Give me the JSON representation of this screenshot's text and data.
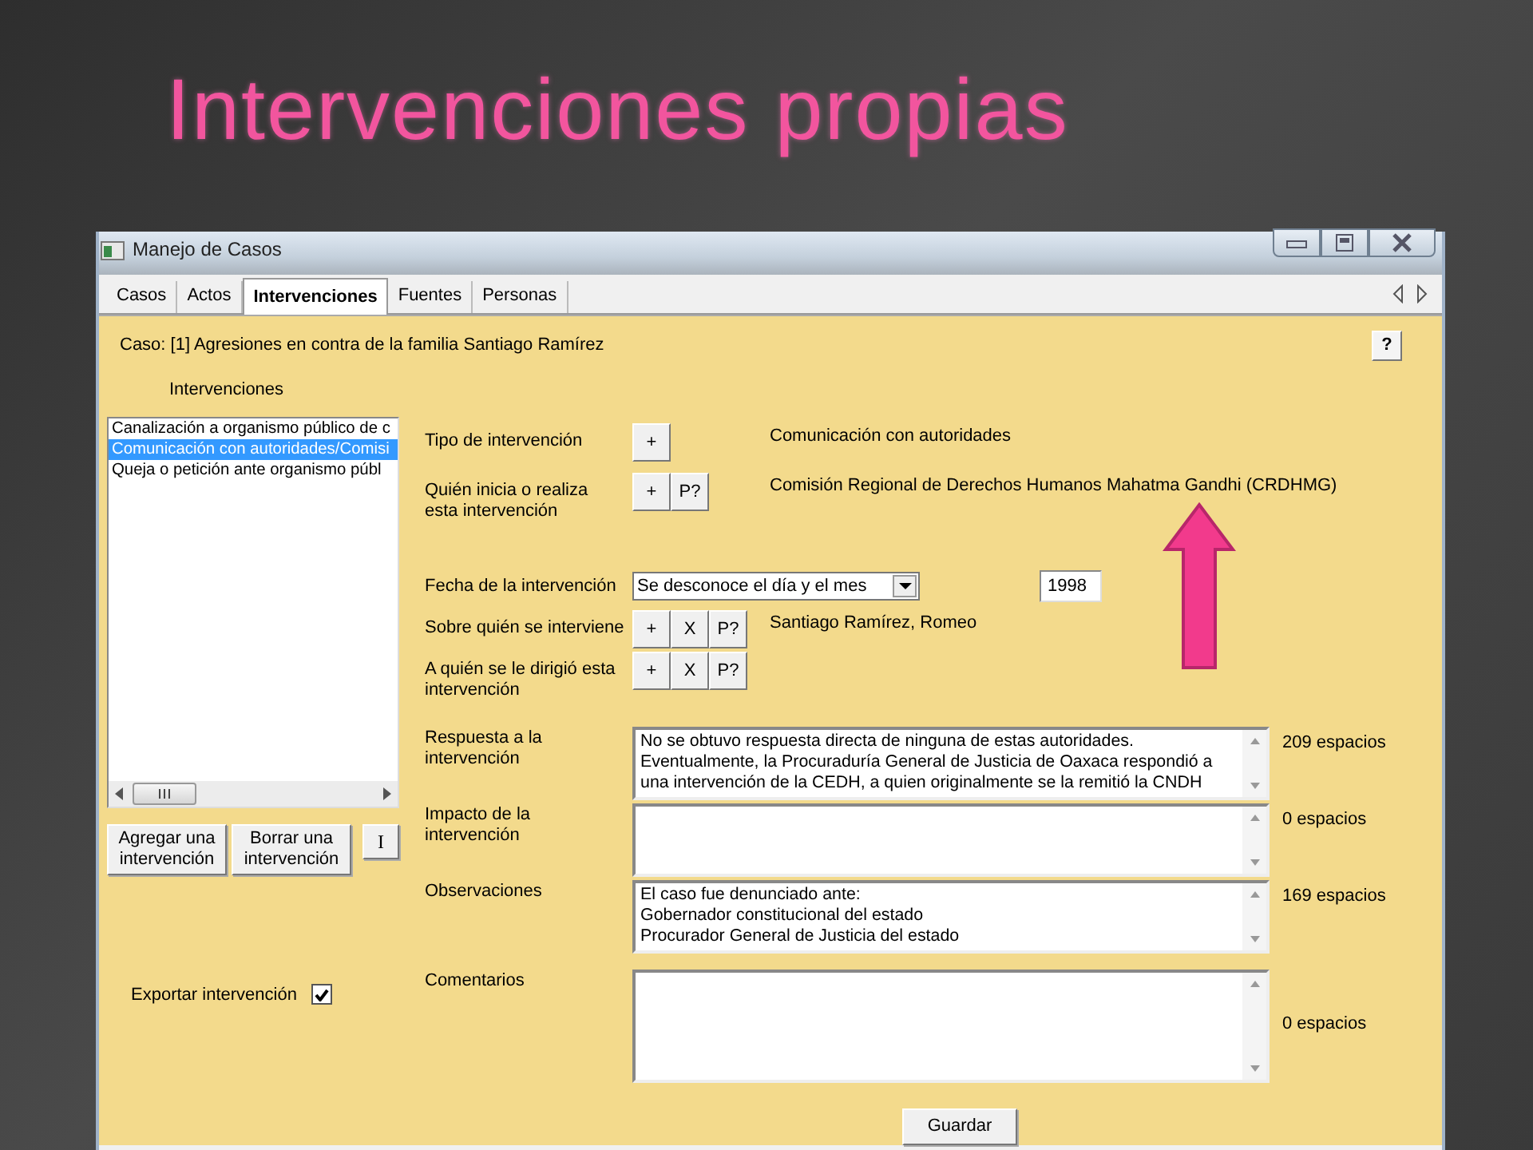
{
  "slide_title": "Intervenciones propias",
  "window": {
    "title": "Manejo de Casos"
  },
  "tabs": [
    {
      "label": "Casos",
      "selected": false
    },
    {
      "label": "Actos",
      "selected": false
    },
    {
      "label": "Intervenciones",
      "selected": true
    },
    {
      "label": "Fuentes",
      "selected": false
    },
    {
      "label": "Personas",
      "selected": false
    }
  ],
  "case_label": "Caso: [1] Agresiones en contra de la familia Santiago Ramírez",
  "help_button": "?",
  "interventions": {
    "heading": "Intervenciones",
    "items": [
      {
        "text": "Canalización a organismo público de c",
        "selected": false
      },
      {
        "text": "Comunicación con autoridades/Comisi",
        "selected": true
      },
      {
        "text": "Queja o petición ante organismo públ",
        "selected": false
      }
    ],
    "buttons": [
      "Agregar una intervención",
      "Borrar una intervención",
      "I"
    ]
  },
  "export": {
    "label": "Exportar intervención",
    "checked": true
  },
  "fields": [
    {
      "kind": "buttons",
      "label": "Tipo de intervención",
      "buttons": [
        "+"
      ],
      "value": "Comunicación con autoridades"
    },
    {
      "kind": "buttons",
      "label": "Quién inicia o realiza\nesta intervención",
      "buttons": [
        "+",
        "P?"
      ],
      "value": "Comisión Regional de Derechos Humanos Mahatma Gandhi (CRDHMG)"
    },
    {
      "kind": "date",
      "label": "Fecha de la intervención",
      "select": "Se desconoce el día y el mes",
      "year": "1998"
    },
    {
      "kind": "buttons",
      "label": "Sobre quién se interviene",
      "buttons": [
        "+",
        "X",
        "P?"
      ],
      "value": "Santiago Ramírez, Romeo"
    },
    {
      "kind": "buttons",
      "label": "A quién se le dirigió esta\nintervención",
      "buttons": [
        "+",
        "X",
        "P?"
      ]
    },
    {
      "kind": "textarea",
      "label": "Respuesta a la\nintervención",
      "text": "No se obtuvo respuesta directa de ninguna de estas autoridades.\nEventualmente, la Procuraduría General de Justicia de Oaxaca respondió a\nuna intervención de la CEDH, a quien originalmente se la remitió la CNDH",
      "count": "209 espacios"
    },
    {
      "kind": "textarea",
      "label": "Impacto de la\nintervención",
      "count": "0 espacios"
    },
    {
      "kind": "textarea",
      "label": "Observaciones",
      "text": "El caso fue denunciado ante:\nGobernador constitucional del estado\nProcurador General de Justicia del estado",
      "count": "169 espacios"
    },
    {
      "kind": "bigtextarea",
      "label": "Comentarios",
      "count": "0 espacios"
    }
  ],
  "save_button": "Guardar"
}
